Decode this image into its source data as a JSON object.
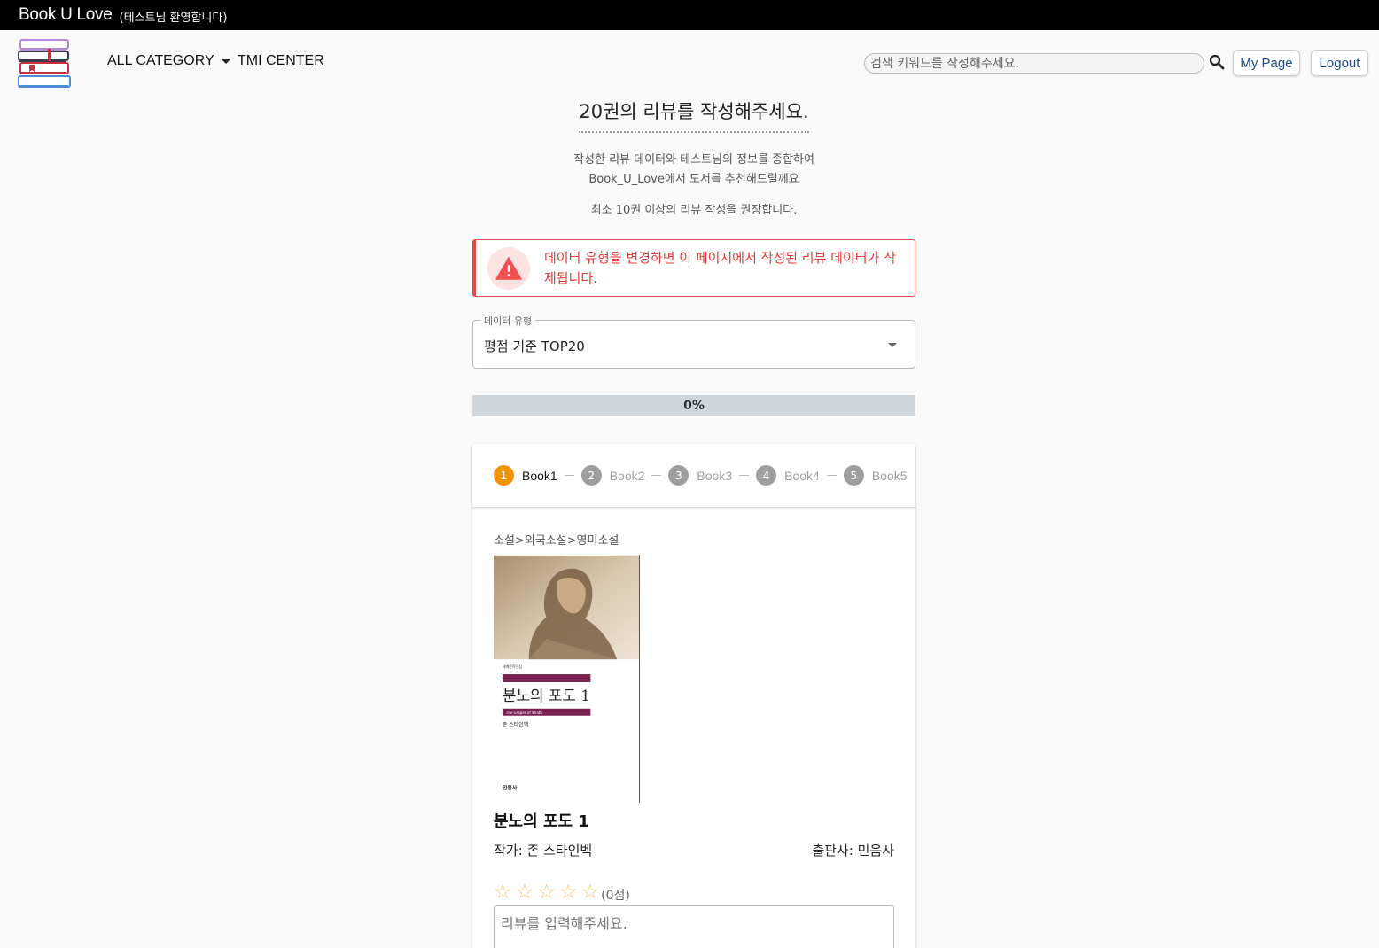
{
  "topbar": {
    "brand": "Book U Love",
    "welcome": "(테스트님 환영합니다)"
  },
  "nav": {
    "all_category": "ALL CATEGORY",
    "tmi_center": "TMI CENTER"
  },
  "header": {
    "search_placeholder": "검색 키워드를 작성해주세요.",
    "mypage": "My Page",
    "logout": "Logout"
  },
  "main": {
    "title": "20권의 리뷰를 작성해주세요.",
    "desc_line1": "작성한 리뷰 데이터와 테스트님의 정보를 종합하여",
    "desc_line2": "Book_U_Love에서 도서를 추천해드릴께요",
    "recommend": "최소 10권 이상의 리뷰 작성을 권장합니다.",
    "alert": "데이터 유형을 변경하면 이 페이지에서 작성된 리뷰 데이터가 삭제됩니다.",
    "select_label": "데이터 유형",
    "select_value": "평점 기준 TOP20",
    "progress": "0%"
  },
  "steps": [
    {
      "num": "1",
      "label": "Book1"
    },
    {
      "num": "2",
      "label": "Book2"
    },
    {
      "num": "3",
      "label": "Book3"
    },
    {
      "num": "4",
      "label": "Book4"
    },
    {
      "num": "5",
      "label": "Book5"
    }
  ],
  "book": {
    "category": "소설>외국소설>영미소설",
    "cover_title": "분노의 포도 1",
    "cover_subtitle": "The Grapes of Wrath",
    "cover_author": "존 스타인벡",
    "title": "분노의 포도 1",
    "author": "작가: 존 스타인벡",
    "publisher": "출판사: 민음사",
    "score": "(0점)",
    "review_placeholder": "리뷰를 입력해주세요."
  },
  "colors": {
    "accent": "#f39200",
    "alert": "#e53935",
    "topbar": "#000000"
  }
}
